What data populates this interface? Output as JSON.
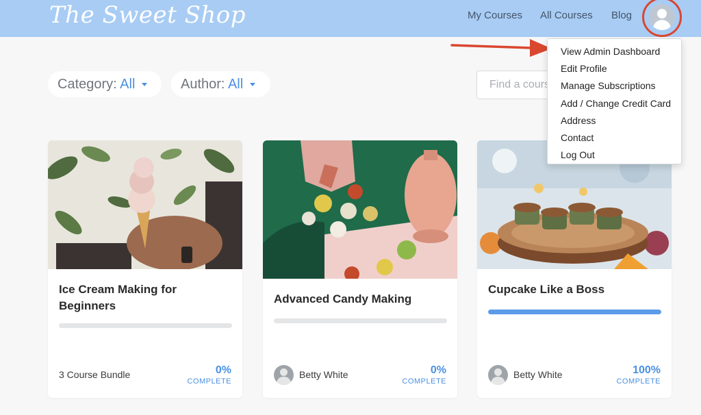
{
  "header": {
    "logo": "The Sweet Shop",
    "nav": [
      "My Courses",
      "All Courses",
      "Blog"
    ],
    "avatar_icon": "user-avatar-icon"
  },
  "dropdown": {
    "items": [
      "View Admin Dashboard",
      "Edit Profile",
      "Manage Subscriptions",
      "Add / Change Credit Card",
      "Address",
      "Contact",
      "Log Out"
    ]
  },
  "filters": {
    "category": {
      "label": "Category:",
      "value": "All"
    },
    "author": {
      "label": "Author:",
      "value": "All"
    },
    "search_placeholder": "Find a course"
  },
  "courses": [
    {
      "title": "Ice Cream Making for Beginners",
      "footer": "3 Course Bundle",
      "percent": "0%",
      "progress": 0,
      "complete_label": "COMPLETE"
    },
    {
      "title": "Advanced Candy Making",
      "author": "Betty White",
      "percent": "0%",
      "progress": 0,
      "complete_label": "COMPLETE"
    },
    {
      "title": "Cupcake Like a Boss",
      "author": "Betty White",
      "percent": "100%",
      "progress": 1,
      "complete_label": "COMPLETE"
    }
  ],
  "colors": {
    "header_bg": "#a8ccf4",
    "accent": "#4a90e2",
    "annotation_red": "#d9472f",
    "page_bg": "#f7f7f8"
  }
}
